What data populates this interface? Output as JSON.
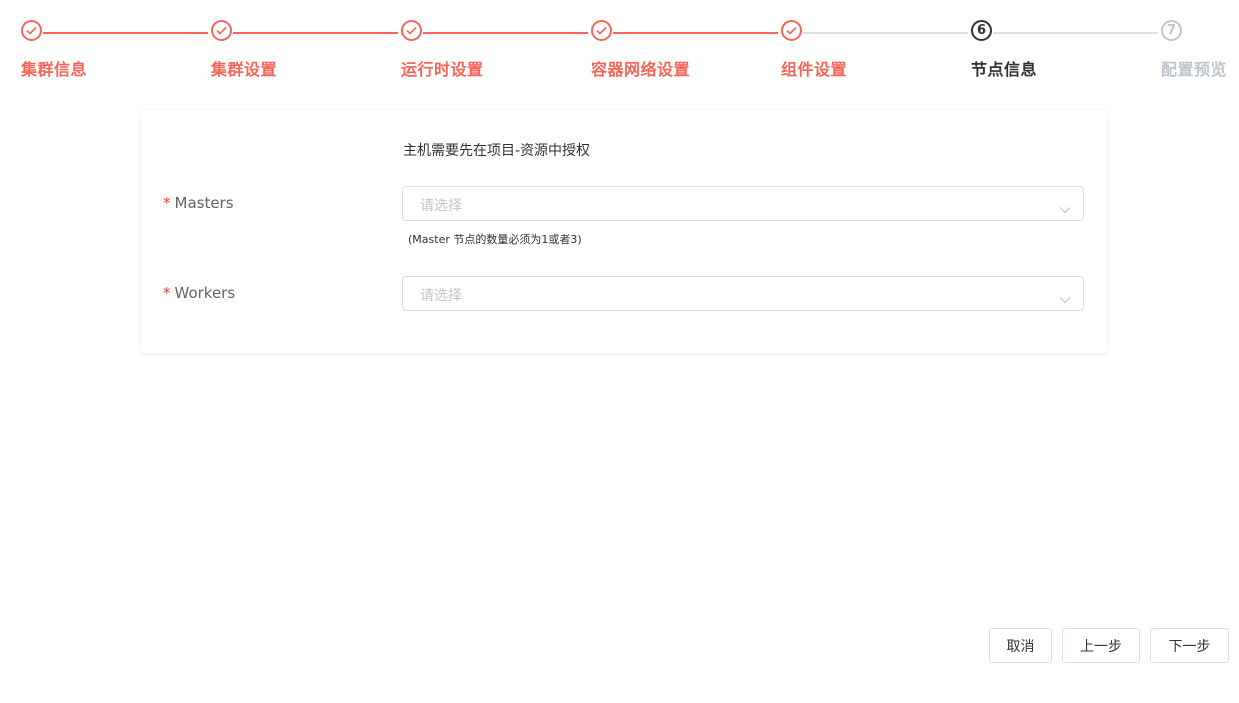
{
  "steps": [
    {
      "number": "1",
      "label": "集群信息",
      "status": "done"
    },
    {
      "number": "2",
      "label": "集群设置",
      "status": "done"
    },
    {
      "number": "3",
      "label": "运行时设置",
      "status": "done"
    },
    {
      "number": "4",
      "label": "容器网络设置",
      "status": "done"
    },
    {
      "number": "5",
      "label": "组件设置",
      "status": "done"
    },
    {
      "number": "6",
      "label": "节点信息",
      "status": "active"
    },
    {
      "number": "7",
      "label": "配置预览",
      "status": "wait"
    }
  ],
  "colors": {
    "accent": "#f5655a",
    "active": "#303133",
    "inactive": "#c0c4cc",
    "required": "#e0413c"
  },
  "form": {
    "notice": "主机需要先在项目-资源中授权",
    "masters": {
      "required_mark": "*",
      "label": "Masters",
      "placeholder": "请选择",
      "hint": "(Master 节点的数量必须为1或者3)"
    },
    "workers": {
      "required_mark": "*",
      "label": "Workers",
      "placeholder": "请选择"
    }
  },
  "footer": {
    "cancel_label": "取消",
    "prev_label": "上一步",
    "next_label": "下一步"
  }
}
